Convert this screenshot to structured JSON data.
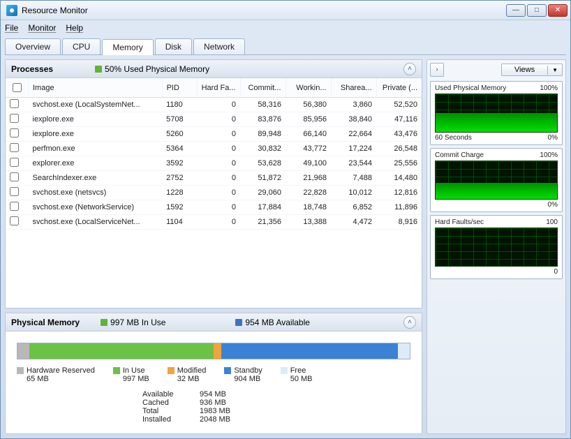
{
  "window": {
    "title": "Resource Monitor"
  },
  "menubar": {
    "file": "File",
    "monitor": "Monitor",
    "help": "Help"
  },
  "tabs": {
    "overview": "Overview",
    "cpu": "CPU",
    "memory": "Memory",
    "disk": "Disk",
    "network": "Network",
    "active": "memory"
  },
  "processes_panel": {
    "title": "Processes",
    "status_swatch_color": "#5fb336",
    "status_text": "50% Used Physical Memory",
    "columns": {
      "chk": "",
      "image": "Image",
      "pid": "PID",
      "hard_faults": "Hard Fa...",
      "commit": "Commit...",
      "working": "Workin...",
      "shareable": "Sharea...",
      "private": "Private (..."
    },
    "rows": [
      {
        "image": "svchost.exe (LocalSystemNet...",
        "pid": "1180",
        "hf": "0",
        "commit": "58,316",
        "working": "56,380",
        "share": "3,860",
        "priv": "52,520"
      },
      {
        "image": "iexplore.exe",
        "pid": "5708",
        "hf": "0",
        "commit": "83,876",
        "working": "85,956",
        "share": "38,840",
        "priv": "47,116"
      },
      {
        "image": "iexplore.exe",
        "pid": "5260",
        "hf": "0",
        "commit": "89,948",
        "working": "66,140",
        "share": "22,664",
        "priv": "43,476"
      },
      {
        "image": "perfmon.exe",
        "pid": "5364",
        "hf": "0",
        "commit": "30,832",
        "working": "43,772",
        "share": "17,224",
        "priv": "26,548"
      },
      {
        "image": "explorer.exe",
        "pid": "3592",
        "hf": "0",
        "commit": "53,628",
        "working": "49,100",
        "share": "23,544",
        "priv": "25,556"
      },
      {
        "image": "SearchIndexer.exe",
        "pid": "2752",
        "hf": "0",
        "commit": "51,872",
        "working": "21,968",
        "share": "7,488",
        "priv": "14,480"
      },
      {
        "image": "svchost.exe (netsvcs)",
        "pid": "1228",
        "hf": "0",
        "commit": "29,060",
        "working": "22,828",
        "share": "10,012",
        "priv": "12,816"
      },
      {
        "image": "svchost.exe (NetworkService)",
        "pid": "1592",
        "hf": "0",
        "commit": "17,884",
        "working": "18,748",
        "share": "6,852",
        "priv": "11,896"
      },
      {
        "image": "svchost.exe (LocalServiceNet...",
        "pid": "1104",
        "hf": "0",
        "commit": "21,356",
        "working": "13,388",
        "share": "4,472",
        "priv": "8,916"
      }
    ]
  },
  "physical_panel": {
    "title": "Physical Memory",
    "inuse_swatch_color": "#5fb336",
    "inuse_text": "997 MB In Use",
    "avail_swatch_color": "#3b73c7",
    "avail_text": "954 MB Available",
    "segments": [
      {
        "color": "#b8b8b8",
        "pct": 3
      },
      {
        "color": "#6cc244",
        "pct": 47
      },
      {
        "color": "#f2a33a",
        "pct": 2
      },
      {
        "color": "#3b82d6",
        "pct": 45
      },
      {
        "color": "#dfeaf7",
        "pct": 3
      }
    ],
    "legend": [
      {
        "color": "#b8b8b8",
        "label": "Hardware Reserved",
        "value": "65 MB"
      },
      {
        "color": "#6cc244",
        "label": "In Use",
        "value": "997 MB"
      },
      {
        "color": "#f2a33a",
        "label": "Modified",
        "value": "32 MB"
      },
      {
        "color": "#3b82d6",
        "label": "Standby",
        "value": "904 MB"
      },
      {
        "color": "#dfeaf7",
        "label": "Free",
        "value": "50 MB"
      }
    ],
    "summary": {
      "available_k": "Available",
      "available_v": "954 MB",
      "cached_k": "Cached",
      "cached_v": "936 MB",
      "total_k": "Total",
      "total_v": "1983 MB",
      "installed_k": "Installed",
      "installed_v": "2048 MB"
    }
  },
  "right": {
    "views_label": "Views",
    "charts": [
      {
        "top_left": "Used Physical Memory",
        "top_right": "100%",
        "bot_left": "60 Seconds",
        "bot_right": "0%",
        "fill_pct": 50
      },
      {
        "top_left": "Commit Charge",
        "top_right": "100%",
        "bot_left": "",
        "bot_right": "0%",
        "fill_pct": 42
      },
      {
        "top_left": "Hard Faults/sec",
        "top_right": "100",
        "bot_left": "",
        "bot_right": "0",
        "fill_pct": 0
      }
    ]
  },
  "chart_data": [
    {
      "type": "area",
      "title": "Used Physical Memory",
      "ylabel": "%",
      "ylim": [
        0,
        100
      ],
      "xlabel": "60 Seconds",
      "values": [
        50,
        50,
        50,
        50,
        50,
        50,
        50,
        50,
        50,
        50,
        50,
        50
      ]
    },
    {
      "type": "area",
      "title": "Commit Charge",
      "ylabel": "%",
      "ylim": [
        0,
        100
      ],
      "values": [
        42,
        42,
        42,
        42,
        42,
        42,
        42,
        42,
        42,
        42,
        42,
        42
      ]
    },
    {
      "type": "area",
      "title": "Hard Faults/sec",
      "ylabel": "faults/sec",
      "ylim": [
        0,
        100
      ],
      "values": [
        0,
        0,
        0,
        0,
        0,
        0,
        0,
        0,
        0,
        0,
        0,
        0
      ]
    },
    {
      "type": "bar",
      "title": "Physical Memory Breakdown (MB)",
      "categories": [
        "Hardware Reserved",
        "In Use",
        "Modified",
        "Standby",
        "Free"
      ],
      "values": [
        65,
        997,
        32,
        904,
        50
      ],
      "ylabel": "MB"
    }
  ]
}
